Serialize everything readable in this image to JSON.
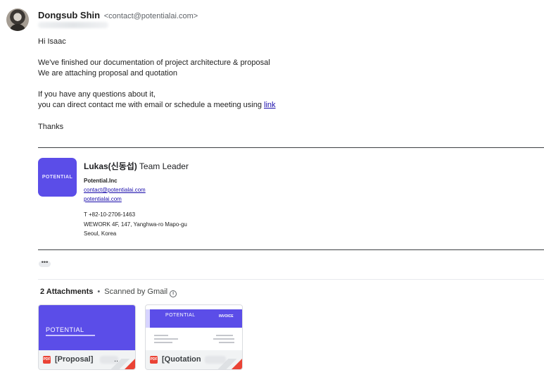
{
  "sender": {
    "name": "Dongsub Shin",
    "email": "<contact@potentialai.com>"
  },
  "body": {
    "greeting": "Hi Isaac",
    "line1": "We've finished our documentation of project architecture & proposal",
    "line2": "We are attaching proposal and quotation",
    "line3": "If you have any questions about it,",
    "line4_prefix": " you can direct contact me with email or schedule a meeting using ",
    "line4_link": "link",
    "closing": "Thanks"
  },
  "signature": {
    "logo_text": "POTENTIAL",
    "name": "Lukas(신동섭)",
    "role": " Team Leader",
    "company": "Potential.Inc",
    "email": "contact@potentialai.com",
    "website": "potentialai.com",
    "phone": "T +82-10-2706-1463",
    "address1": "WEWORK 4F, 147, Yanghwa-ro Mapo-gu",
    "address2": "Seoul, Korea"
  },
  "more_dots": "•••",
  "attachments": {
    "count_label": "2 Attachments",
    "separator": "•",
    "scanned_label": "Scanned by Gmail",
    "info_icon": "i",
    "items": [
      {
        "filename": "[Proposal]",
        "suffix": "..",
        "type_icon": "PDF",
        "thumb_brand": "POTENTIAL"
      },
      {
        "filename": "[Quotation",
        "type_icon": "PDF",
        "thumb_brand": "POTENTIAL",
        "thumb_label": "INVOICE"
      }
    ]
  },
  "colors": {
    "brand": "#5b4de8",
    "link": "#1a0dab",
    "pdf": "#ea4335"
  }
}
